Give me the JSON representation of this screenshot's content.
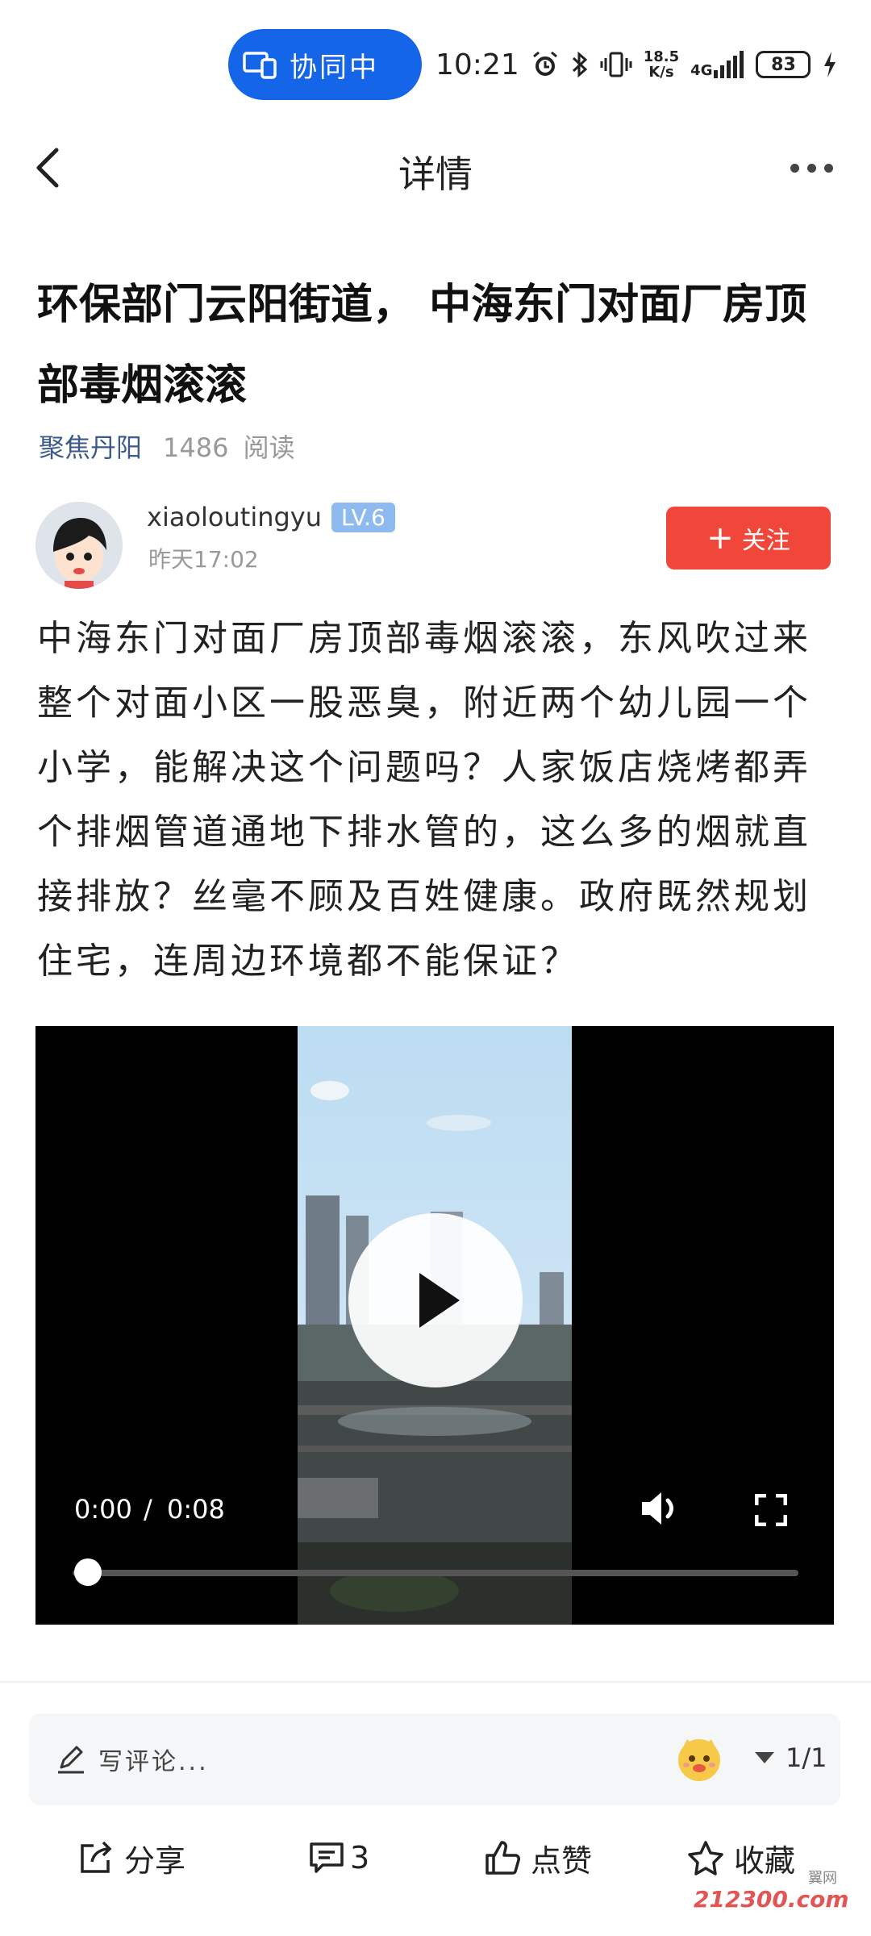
{
  "status_bar": {
    "collab_label": "协同中",
    "time": "10:21",
    "net_speed_value": "18.5",
    "net_speed_unit": "K/s",
    "network_type": "4G",
    "battery": "83"
  },
  "header": {
    "title": "详情"
  },
  "article": {
    "title": "环保部门云阳街道， 中海东门对面厂房顶部毒烟滚滚",
    "source": "聚焦丹阳",
    "read_count": "1486",
    "read_label": "阅读",
    "author_name": "xiaoloutingyu",
    "author_level": "LV.6",
    "post_time": "昨天17:02",
    "follow_label": "关注",
    "body": "中海东门对面厂房顶部毒烟滚滚，东风吹过来整个对面小区一股恶臭，附近两个幼儿园一个小学，能解决这个问题吗？人家饭店烧烤都弄个排烟管道通地下排水管的，这么多的烟就直接排放？丝毫不顾及百姓健康。政府既然规划住宅，连周边环境都不能保证？"
  },
  "video": {
    "current_time": "0:00",
    "separator": "/",
    "duration": "0:08",
    "progress": 0
  },
  "comment_bar": {
    "placeholder": "写评论...",
    "page_indicator": "1/1"
  },
  "actions": {
    "share": "分享",
    "comments": "3",
    "like": "点赞",
    "favorite": "收藏"
  },
  "watermark": {
    "text": "212300.com",
    "sub": "翼网"
  },
  "colors": {
    "collab_pill": "#1565e8",
    "follow_button": "#f0473a",
    "level_badge": "#8fbaf0",
    "source_link": "#3b5a8a"
  }
}
